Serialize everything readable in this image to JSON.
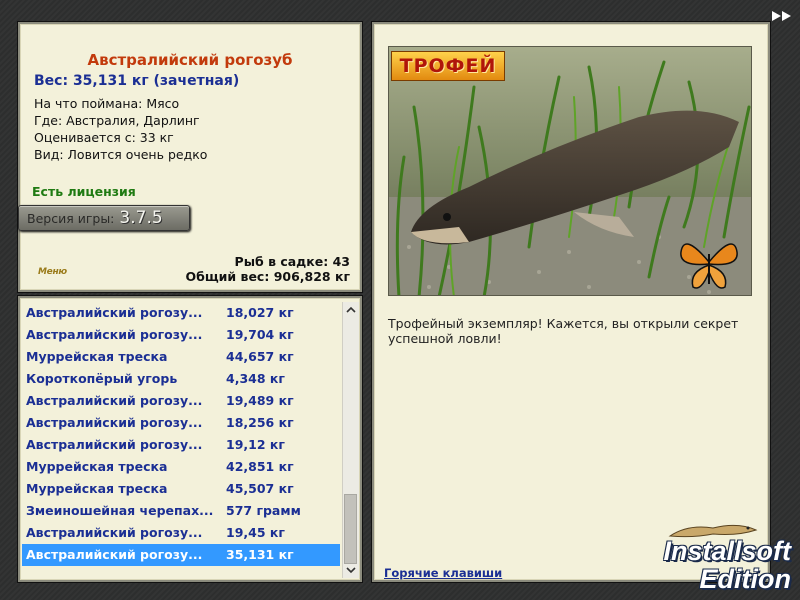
{
  "fish": {
    "name": "Австралийский рогозуб",
    "weight": "Вес: 35,131 кг (зачетная)",
    "bait": "На что поймана: Мясо",
    "location": "Где: Австралия, Дарлинг",
    "valued_from": "Оценивается с: 33 кг",
    "rarity": "Вид: Ловится очень редко"
  },
  "license": "Есть лицензия",
  "version": {
    "label": "Версия игры:",
    "value": "3.7.5"
  },
  "stats": {
    "fish_count": "Рыб в садке: 43",
    "total_weight": "Общий вес: 906,828 кг"
  },
  "menu_label": "Меню",
  "catch_list": [
    {
      "name": "Австралийский рогозу...",
      "weight": "18,027 кг"
    },
    {
      "name": "Австралийский рогозу...",
      "weight": "19,704 кг"
    },
    {
      "name": "Муррейская треска",
      "weight": "44,657 кг"
    },
    {
      "name": "Короткопёрый угорь",
      "weight": "4,348 кг"
    },
    {
      "name": "Австралийский рогозу...",
      "weight": "19,489 кг"
    },
    {
      "name": "Австралийский рогозу...",
      "weight": "18,256 кг"
    },
    {
      "name": "Австралийский рогозу...",
      "weight": "19,12 кг"
    },
    {
      "name": "Муррейская треска",
      "weight": "42,851 кг"
    },
    {
      "name": "Муррейская треска",
      "weight": "45,507 кг"
    },
    {
      "name": "Змеиношейная черепах...",
      "weight": "577 грамм"
    },
    {
      "name": "Австралийский рогозу...",
      "weight": "19,45 кг"
    },
    {
      "name": "Австралийский рогозу...",
      "weight": "35,131 кг",
      "selected": true
    }
  ],
  "trophy": {
    "badge": "ТРОФЕЙ",
    "message": "Трофейный экземпляр! Кажется, вы открыли секрет успешной ловли!"
  },
  "hotkeys_link": "Горячие клавиши",
  "watermark": {
    "line1": "Installsoft",
    "line2": "Edition"
  },
  "colors": {
    "panel_bg": "#f3f1da",
    "title": "#c23a0c",
    "link": "#1b2f94",
    "license": "#1f7a12",
    "selection": "#3399ff"
  },
  "icons": {
    "forward": "fast-forward-icon",
    "scroll_up": "chevron-up-icon",
    "scroll_down": "chevron-down-icon",
    "butterfly": "butterfly-icon",
    "lizard": "lizard-icon"
  }
}
